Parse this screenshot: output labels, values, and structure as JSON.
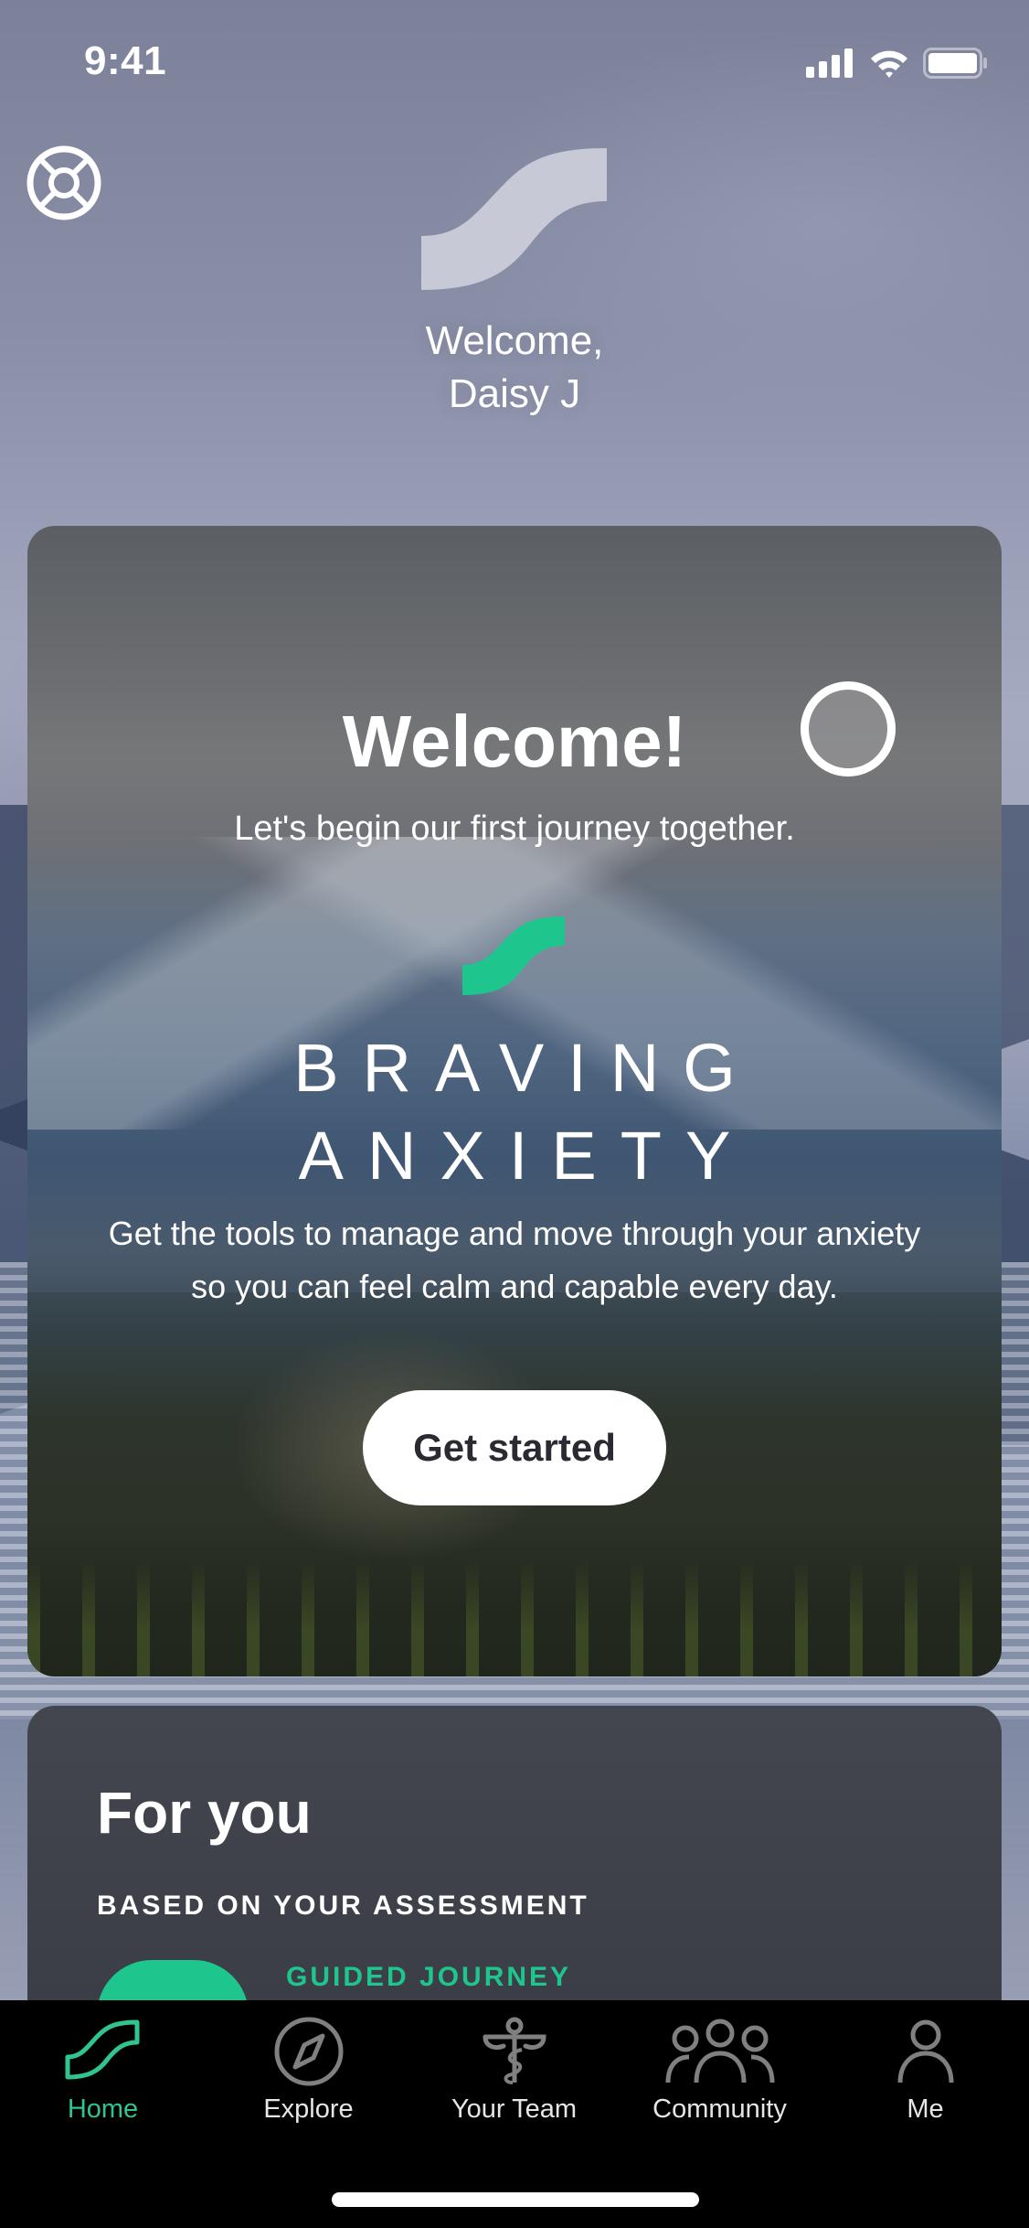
{
  "status_bar": {
    "time": "9:41",
    "icons": [
      "cellular-signal-icon",
      "wifi-icon",
      "battery-icon"
    ]
  },
  "header": {
    "help_icon": "lifebuoy-icon",
    "logo": "wave-logo",
    "greeting_line1": "Welcome,",
    "greeting_line2": "Daisy J"
  },
  "welcome_card": {
    "title": "Welcome!",
    "subtitle": "Let's begin our first journey together.",
    "program_title_line1": "BRAVING",
    "program_title_line2": "ANXIETY",
    "description_line1": "Get the tools to manage and move through your anxiety",
    "description_line2": "so you can feel calm and capable every day.",
    "cta_label": "Get started"
  },
  "for_you": {
    "title": "For you",
    "subtitle": "BASED ON YOUR ASSESSMENT",
    "item_tag": "GUIDED JOURNEY"
  },
  "tab_bar": {
    "active": "Home",
    "tabs": [
      {
        "label": "Home",
        "icon": "wave-icon"
      },
      {
        "label": "Explore",
        "icon": "compass-icon"
      },
      {
        "label": "Your Team",
        "icon": "caduceus-icon"
      },
      {
        "label": "Community",
        "icon": "group-icon"
      },
      {
        "label": "Me",
        "icon": "person-icon"
      }
    ]
  },
  "colors": {
    "accent": "#1ec68d",
    "tab_active": "#30c48f",
    "tab_inactive_icon": "#808080",
    "card_dark": "#3f414a"
  }
}
